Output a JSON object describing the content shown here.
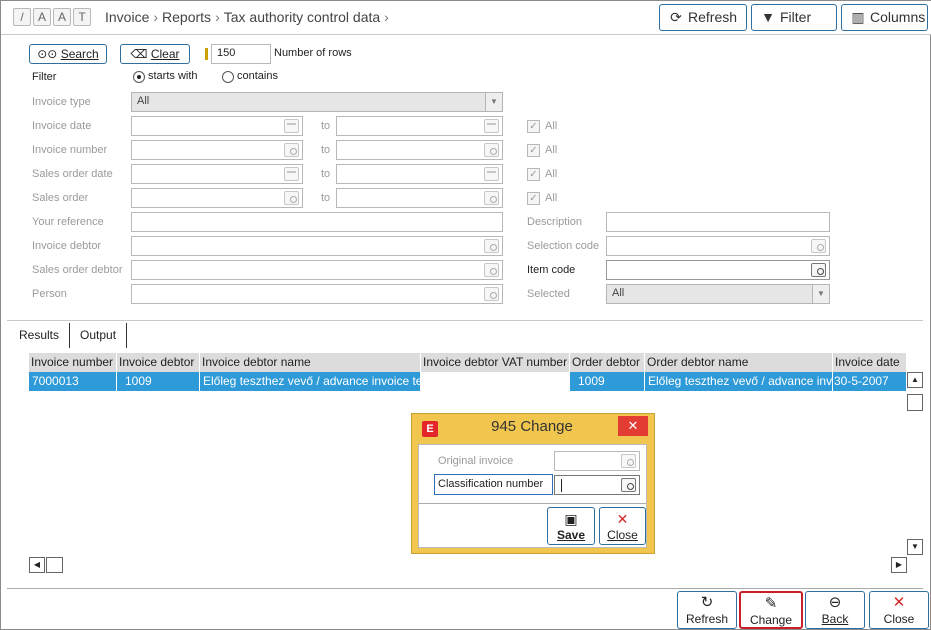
{
  "topbar": {
    "quick_links": [
      "/",
      "A",
      "A",
      "T"
    ],
    "breadcrumb": [
      "Invoice",
      "Reports",
      "Tax authority control data"
    ],
    "refresh_label": "Refresh",
    "filter_label": "Filter",
    "columns_label": "Columns"
  },
  "filter": {
    "search_label": "Search",
    "clear_label": "Clear",
    "rows_value": "150",
    "rows_label": "Number of rows",
    "filter_label": "Filter",
    "starts_with_label": "starts with",
    "contains_label": "contains",
    "invoice_type_label": "Invoice type",
    "invoice_type_value": "All",
    "invoice_date_label": "Invoice date",
    "invoice_number_label": "Invoice number",
    "sales_order_date_label": "Sales order date",
    "sales_order_label": "Sales order",
    "to_label": "to",
    "all_label": "All",
    "your_reference_label": "Your reference",
    "invoice_debtor_label": "Invoice debtor",
    "sales_order_debtor_label": "Sales order debtor",
    "person_label": "Person",
    "description_label": "Description",
    "selection_code_label": "Selection code",
    "item_code_label": "Item code",
    "selected_label": "Selected",
    "selected_value": "All"
  },
  "tabs": [
    "Results",
    "Output"
  ],
  "grid": {
    "columns": [
      "Invoice number",
      "Invoice debtor",
      "Invoice debtor name",
      "Invoice debtor VAT number",
      "Order debtor",
      "Order debtor name",
      "Invoice date"
    ],
    "rows": [
      [
        "7000013",
        "1009",
        "Előleg teszthez vevő / advance invoice test",
        "",
        "1009",
        "Előleg teszthez vevő / advance invoice test",
        "30-5-2007"
      ]
    ]
  },
  "bottom": {
    "refresh_label": "Refresh",
    "change_label": "Change",
    "back_label": "Back",
    "close_label": "Close"
  },
  "dialog": {
    "title": "945 Change",
    "logo": "E",
    "original_invoice_label": "Original invoice",
    "classification_number_label": "Classification number",
    "save_label": "Save",
    "close_label": "Close"
  },
  "colors": {
    "accent": "#2f6f9f",
    "selected_row": "#2e9ad8",
    "dialog_bg": "#f1c64f",
    "close_red": "#e23c33",
    "highlight_border": "#c8202a"
  }
}
